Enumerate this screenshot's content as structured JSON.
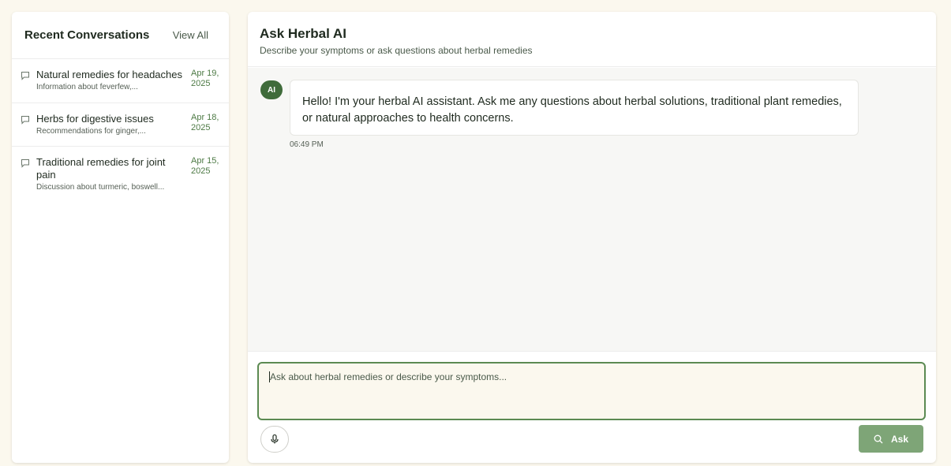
{
  "sidebar": {
    "title": "Recent Conversations",
    "view_all": "View All",
    "conversations": [
      {
        "title": "Natural remedies for headaches",
        "date": "Apr 19, 2025",
        "summary": "Information about feverfew,..."
      },
      {
        "title": "Herbs for digestive issues",
        "date": "Apr 18, 2025",
        "summary": "Recommendations for ginger,..."
      },
      {
        "title": "Traditional remedies for joint pain",
        "date": "Apr 15, 2025",
        "summary": "Discussion about turmeric, boswell..."
      }
    ]
  },
  "main": {
    "title": "Ask Herbal AI",
    "subtitle": "Describe your symptoms or ask questions about herbal remedies",
    "messages": [
      {
        "avatar": "AI",
        "text": "Hello! I'm your herbal AI assistant. Ask me any questions about herbal solutions, traditional plant remedies, or natural approaches to health concerns.",
        "time": "06:49 PM"
      }
    ],
    "input_placeholder": "Ask about herbal remedies or describe your symptoms...",
    "ask_label": "Ask"
  },
  "icons": {
    "conversation": "chat-bubble-icon",
    "mic": "microphone-icon",
    "search": "search-icon"
  },
  "colors": {
    "accent": "#3f6b3a",
    "button": "#7ea577",
    "page_bg": "#fbf8ee"
  }
}
